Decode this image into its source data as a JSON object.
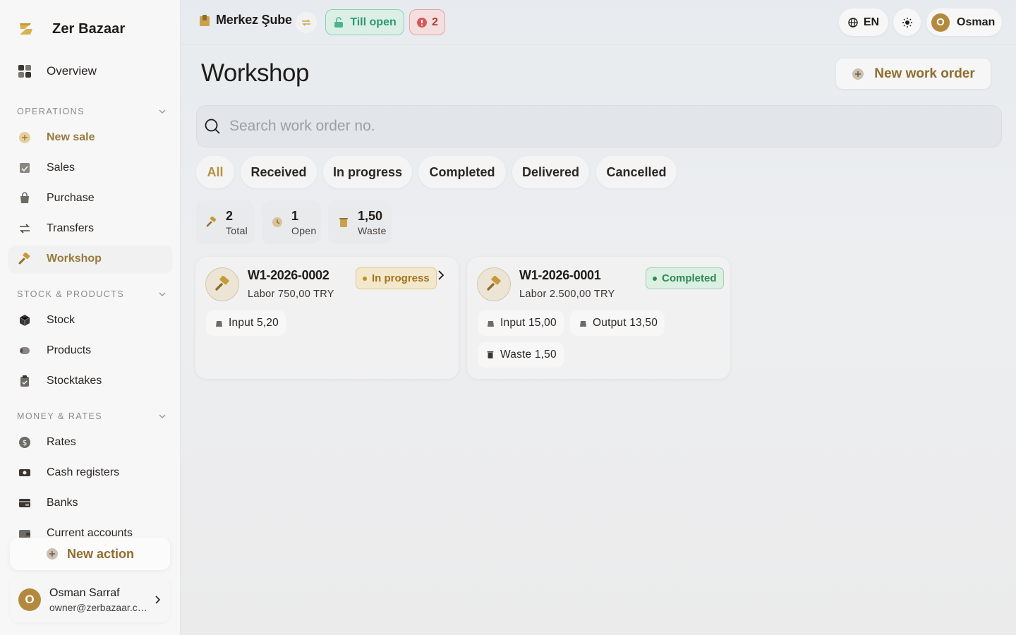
{
  "brand": {
    "name": "Zer Bazaar"
  },
  "sidebar": {
    "overview": {
      "label": "Overview"
    },
    "sections": [
      {
        "title": "OPERATIONS",
        "items": [
          {
            "label": "New sale",
            "icon": "plus-circle-icon"
          },
          {
            "label": "Sales",
            "icon": "receipt-icon"
          },
          {
            "label": "Purchase",
            "icon": "shopping-bag-icon"
          },
          {
            "label": "Transfers",
            "icon": "arrows-swap-icon"
          },
          {
            "label": "Workshop",
            "icon": "hammer-icon",
            "selected": true
          }
        ]
      },
      {
        "title": "STOCK & PRODUCTS",
        "items": [
          {
            "label": "Stock",
            "icon": "cube-icon"
          },
          {
            "label": "Products",
            "icon": "tag-icon"
          },
          {
            "label": "Stocktakes",
            "icon": "clipboard-icon"
          }
        ]
      },
      {
        "title": "MONEY & RATES",
        "items": [
          {
            "label": "Rates",
            "icon": "dollar-circle-icon"
          },
          {
            "label": "Cash registers",
            "icon": "banknote-icon"
          },
          {
            "label": "Banks",
            "icon": "bank-card-icon"
          },
          {
            "label": "Current accounts",
            "icon": "wallet-icon"
          }
        ]
      }
    ],
    "new_action": {
      "label": "New action"
    },
    "user": {
      "initial": "O",
      "name": "Osman Sarraf",
      "email": "owner@zerbazaar.com"
    }
  },
  "topbar": {
    "branch": "Merkez Şube",
    "till": "Till open",
    "alerts": "2",
    "language": "EN",
    "user": {
      "initial": "O",
      "name": "Osman"
    }
  },
  "page": {
    "title": "Workshop",
    "new_button": "New work order",
    "search": {
      "placeholder": "Search work order no.",
      "value": ""
    },
    "tabs": [
      {
        "label": "All",
        "active": true
      },
      {
        "label": "Received"
      },
      {
        "label": "In progress"
      },
      {
        "label": "Completed"
      },
      {
        "label": "Delivered"
      },
      {
        "label": "Cancelled"
      }
    ],
    "stats": [
      {
        "value": "2",
        "label": "Total",
        "icon": "hammer-icon"
      },
      {
        "value": "1",
        "label": "Open",
        "icon": "clock-icon"
      },
      {
        "value": "1,50",
        "label": "Waste",
        "icon": "trash-icon"
      }
    ],
    "orders": [
      {
        "no": "W1-2026-0002",
        "labor": "Labor 750,00 TRY",
        "status": "In progress",
        "status_color": "#a07320",
        "chips": [
          "Input 5,20"
        ]
      },
      {
        "no": "W1-2026-0001",
        "labor": "Labor 2.500,00 TRY",
        "status": "Completed",
        "status_color": "#2b8a52",
        "chips": [
          "Input 15,00",
          "Output 13,50",
          "Waste 1,50"
        ]
      }
    ]
  },
  "colors": {
    "accent": "#b8913f",
    "accent_dark": "#8f6d2e",
    "success": "#2b9a70",
    "danger": "#b03a3a"
  }
}
